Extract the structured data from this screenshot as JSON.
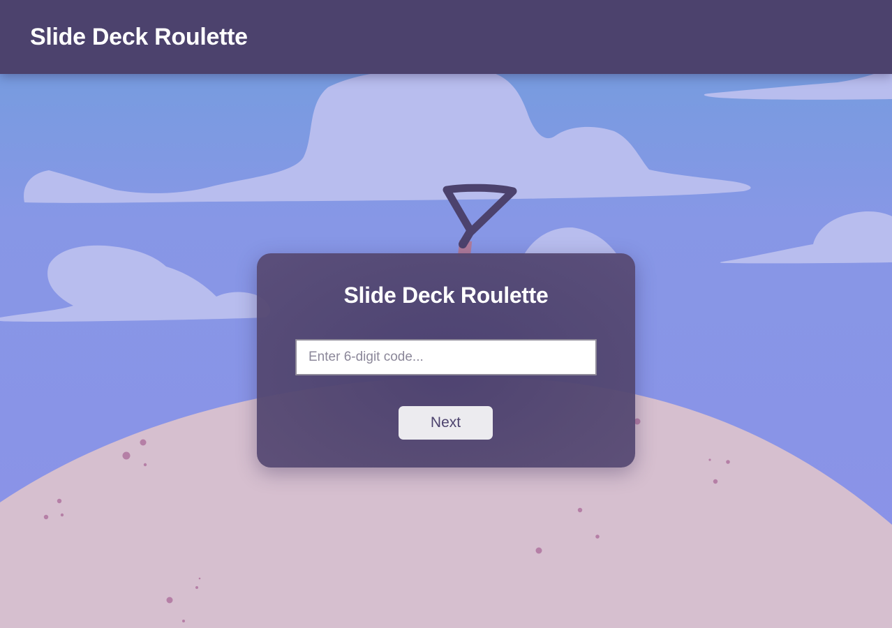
{
  "header": {
    "title": "Slide Deck Roulette"
  },
  "card": {
    "title": "Slide Deck Roulette",
    "code_input": {
      "placeholder": "Enter 6-digit code...",
      "value": ""
    },
    "next_label": "Next"
  },
  "colors": {
    "header_bg": "#4c426d",
    "card_bg": "#524670",
    "sky_top": "#749ddd",
    "sky": "#8a91e8",
    "cloud": "#b8bdee",
    "hill": "#d6bfcf",
    "speckle": "#b57fa6",
    "shovel": "#4c426d",
    "button_bg": "#ecebef",
    "button_text": "#4c426d"
  },
  "icons": {
    "shovel": "shovel-icon"
  }
}
